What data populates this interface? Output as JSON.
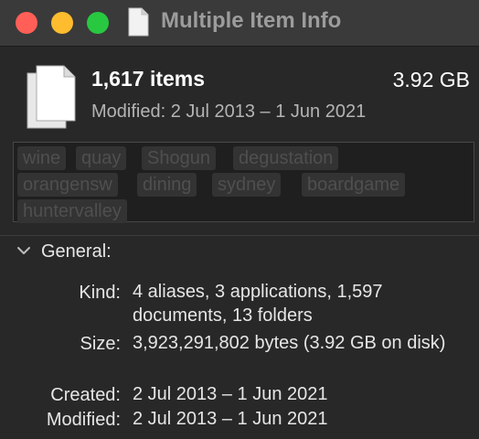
{
  "window": {
    "title": "Multiple Item Info"
  },
  "summary": {
    "item_count": "1,617 items",
    "total_size": "3.92 GB",
    "modified_range": "Modified: 2 Jul 2013 – 1 Jun 2021"
  },
  "tags": [
    "wine",
    "quay",
    "Shogun",
    "degustation",
    "orangensw",
    "dining",
    "sydney",
    "boardgame",
    "huntervalley"
  ],
  "general": {
    "title": "General:",
    "kind_label": "Kind:",
    "kind_value": "4 aliases, 3 applications, 1,597 documents, 13 folders",
    "size_label": "Size:",
    "size_value": "3,923,291,802 bytes (3.92 GB on disk)",
    "created_label": "Created:",
    "created_value": "2 Jul 2013 – 1 Jun 2021",
    "modified_label": "Modified:",
    "modified_value": "2 Jul 2013 – 1 Jun 2021"
  },
  "icons": {
    "title": "document-icon",
    "header": "documents-stack-icon",
    "section": "chevron-down-icon"
  },
  "colors": {
    "close": "#ff5f57",
    "minimize": "#febc2e",
    "maximize": "#28c840",
    "background": "#282828"
  }
}
